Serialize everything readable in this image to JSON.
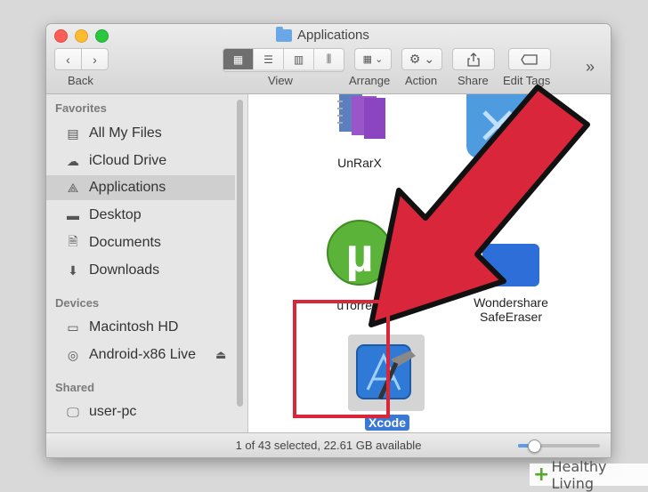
{
  "window": {
    "title": "Applications"
  },
  "toolbar": {
    "back_label": "Back",
    "view_label": "View",
    "arrange_label": "Arrange",
    "action_label": "Action",
    "share_label": "Share",
    "edit_tags_label": "Edit Tags",
    "overflow_label": "»"
  },
  "sidebar": {
    "favorites_header": "Favorites",
    "favorites": [
      {
        "label": "All My Files",
        "icon": "all-files-icon"
      },
      {
        "label": "iCloud Drive",
        "icon": "cloud-icon"
      },
      {
        "label": "Applications",
        "icon": "applications-icon",
        "selected": true
      },
      {
        "label": "Desktop",
        "icon": "desktop-icon"
      },
      {
        "label": "Documents",
        "icon": "documents-icon"
      },
      {
        "label": "Downloads",
        "icon": "downloads-icon"
      }
    ],
    "devices_header": "Devices",
    "devices": [
      {
        "label": "Macintosh HD",
        "icon": "harddisk-icon"
      },
      {
        "label": "Android-x86 Live",
        "icon": "disc-icon",
        "eject": "⏏"
      }
    ],
    "shared_header": "Shared",
    "shared": [
      {
        "label": "user-pc",
        "icon": "computer-icon"
      }
    ]
  },
  "files": [
    {
      "name": "UnRarX",
      "icon": "unrarx-icon"
    },
    {
      "name": "uTorrent",
      "icon": "utorrent-icon",
      "glyph": "µ"
    },
    {
      "name": "Wondershare",
      "name2": "SafeEraser",
      "icon": "safeeraser-icon"
    },
    {
      "name": "Xcode",
      "icon": "xcode-icon",
      "selected": true
    }
  ],
  "status": {
    "text": "1 of 43 selected, 22.61 GB available",
    "icon_size_level": 0.18
  },
  "watermark": {
    "plus": "+",
    "text": "Healthy Living"
  },
  "colors": {
    "accent": "#3a78d6",
    "arrow": "#d9263a",
    "selection": "#cfcfcf"
  }
}
